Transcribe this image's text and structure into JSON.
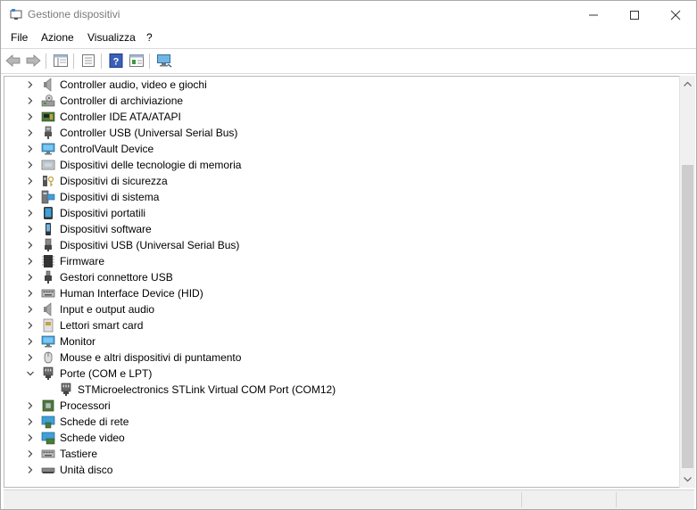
{
  "window": {
    "title": "Gestione dispositivi"
  },
  "menu": [
    "File",
    "Azione",
    "Visualizza",
    "?"
  ],
  "toolbar": {
    "buttons": [
      "back-arrow-icon",
      "forward-arrow-icon",
      "show-hide-console-tree-icon",
      "properties-icon",
      "help-icon",
      "device-view-icon",
      "scan-hardware-icon"
    ]
  },
  "tree": {
    "items": [
      {
        "label": "Controller audio, video e giochi",
        "icon": "speaker-icon",
        "expanded": false,
        "level": 0
      },
      {
        "label": "Controller di archiviazione",
        "icon": "storage-controller-icon",
        "expanded": false,
        "level": 0
      },
      {
        "label": "Controller IDE ATA/ATAPI",
        "icon": "ide-controller-icon",
        "expanded": false,
        "level": 0
      },
      {
        "label": "Controller USB (Universal Serial Bus)",
        "icon": "usb-plug-icon",
        "expanded": false,
        "level": 0
      },
      {
        "label": "ControlVault Device",
        "icon": "monitor-icon",
        "expanded": false,
        "level": 0
      },
      {
        "label": "Dispositivi delle tecnologie di memoria",
        "icon": "memory-device-icon",
        "expanded": false,
        "level": 0
      },
      {
        "label": "Dispositivi di sicurezza",
        "icon": "security-key-icon",
        "expanded": false,
        "level": 0
      },
      {
        "label": "Dispositivi di sistema",
        "icon": "system-device-icon",
        "expanded": false,
        "level": 0
      },
      {
        "label": "Dispositivi portatili",
        "icon": "portable-device-icon",
        "expanded": false,
        "level": 0
      },
      {
        "label": "Dispositivi software",
        "icon": "software-device-icon",
        "expanded": false,
        "level": 0
      },
      {
        "label": "Dispositivi USB (Universal Serial Bus)",
        "icon": "usb-device-icon",
        "expanded": false,
        "level": 0
      },
      {
        "label": "Firmware",
        "icon": "chip-icon",
        "expanded": false,
        "level": 0
      },
      {
        "label": "Gestori connettore USB",
        "icon": "usb-connector-icon",
        "expanded": false,
        "level": 0
      },
      {
        "label": "Human Interface Device (HID)",
        "icon": "keyboard-icon",
        "expanded": false,
        "level": 0
      },
      {
        "label": "Input e output audio",
        "icon": "speaker-icon",
        "expanded": false,
        "level": 0
      },
      {
        "label": "Lettori smart card",
        "icon": "smart-card-icon",
        "expanded": false,
        "level": 0
      },
      {
        "label": "Monitor",
        "icon": "monitor-icon",
        "expanded": false,
        "level": 0
      },
      {
        "label": "Mouse e altri dispositivi di puntamento",
        "icon": "mouse-icon",
        "expanded": false,
        "level": 0
      },
      {
        "label": "Porte (COM e LPT)",
        "icon": "port-icon",
        "expanded": true,
        "level": 0
      },
      {
        "label": "STMicroelectronics STLink Virtual COM Port (COM12)",
        "icon": "port-icon",
        "expanded": null,
        "level": 1
      },
      {
        "label": "Processori",
        "icon": "processor-icon",
        "expanded": false,
        "level": 0
      },
      {
        "label": "Schede di rete",
        "icon": "network-adapter-icon",
        "expanded": false,
        "level": 0
      },
      {
        "label": "Schede video",
        "icon": "display-adapter-icon",
        "expanded": false,
        "level": 0
      },
      {
        "label": "Tastiere",
        "icon": "keyboard-icon",
        "expanded": false,
        "level": 0
      },
      {
        "label": "Unità disco",
        "icon": "disk-drive-icon",
        "expanded": false,
        "level": 0
      }
    ]
  },
  "colors": {
    "selection": "#cce8ff",
    "scroll_thumb": "#cdcdcd",
    "title_text": "#7a7a7a"
  }
}
